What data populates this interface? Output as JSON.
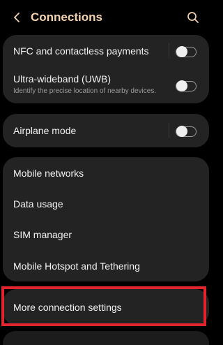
{
  "header": {
    "title": "Connections",
    "back_icon": "chevron-left-icon",
    "search_icon": "search-icon"
  },
  "colors": {
    "title": "#f5d3b0",
    "background": "#000000",
    "card": "#232323",
    "highlight": "#e0252f"
  },
  "group1": {
    "nfc": {
      "title": "NFC and contactless payments",
      "toggle_on": false
    },
    "uwb": {
      "title": "Ultra-wideband (UWB)",
      "subtitle": "Identify the precise location of nearby devices.",
      "toggle_on": false
    }
  },
  "group2": {
    "airplane": {
      "title": "Airplane mode",
      "toggle_on": false
    }
  },
  "group3": {
    "items": [
      {
        "title": "Mobile networks"
      },
      {
        "title": "Data usage"
      },
      {
        "title": "SIM manager"
      },
      {
        "title": "Mobile Hotspot and Tethering"
      }
    ]
  },
  "group4": {
    "more": {
      "title": "More connection settings"
    }
  }
}
